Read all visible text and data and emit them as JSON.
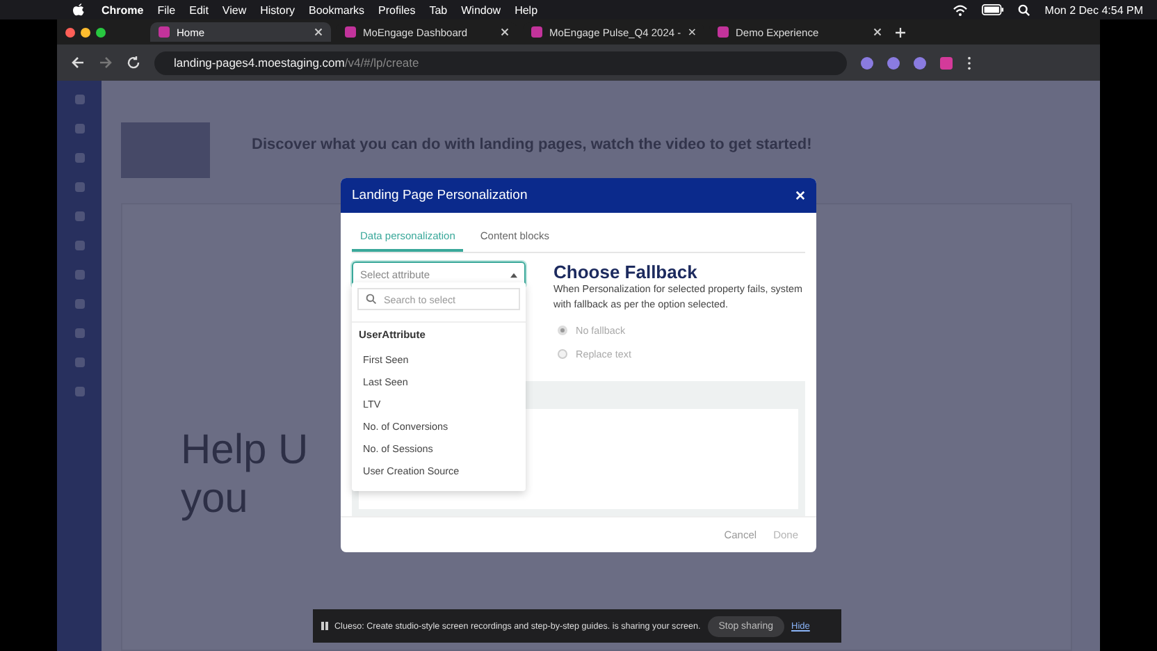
{
  "menubar": {
    "app": "Chrome",
    "items": [
      "File",
      "Edit",
      "View",
      "History",
      "Bookmarks",
      "Profiles",
      "Tab",
      "Window",
      "Help"
    ],
    "clock": "Mon 2 Dec  4:54 PM"
  },
  "browser_tabs": [
    {
      "label": "Home",
      "selected": true
    },
    {
      "label": "MoEngage Dashboard",
      "selected": false
    },
    {
      "label": "MoEngage Pulse_Q4 2024 -",
      "selected": false
    },
    {
      "label": "Demo Experience",
      "selected": false
    }
  ],
  "address_bar": {
    "domain": "landing-pages4.moestaging.com",
    "path": "/v4/#/lp/create"
  },
  "page": {
    "heading": "Discover what you can do with landing pages, watch the video to get started!",
    "hero_line_1": "Help U",
    "hero_line_2": "you"
  },
  "dialog": {
    "title": "Landing Page Personalization",
    "tabs": [
      {
        "label": "Data personalization",
        "selected": true
      },
      {
        "label": "Content blocks",
        "selected": false
      }
    ],
    "select": {
      "placeholder": "Select attribute",
      "expanded": true
    },
    "dropdown": {
      "search_placeholder": "Search to select",
      "group": "UserAttribute",
      "options": [
        "First Seen",
        "Last Seen",
        "LTV",
        "No. of Conversions",
        "No. of Sessions",
        "User Creation Source"
      ]
    },
    "fallback_title": "Choose Fallback",
    "fallback_text": "When Personalization for selected property fails, system with fallback as per the option selected.",
    "fallback_options": [
      {
        "label": "No fallback",
        "selected": true,
        "disabled": true
      },
      {
        "label": "Replace text",
        "selected": false,
        "disabled": true
      }
    ],
    "buttons": [
      {
        "label": "Cancel",
        "disabled": false
      },
      {
        "label": "Done",
        "disabled": true
      }
    ]
  },
  "share_bar": {
    "message": "Clueso: Create studio-style screen recordings and step-by-step guides. is sharing your screen.",
    "stop": "Stop sharing",
    "hide": "Hide"
  }
}
